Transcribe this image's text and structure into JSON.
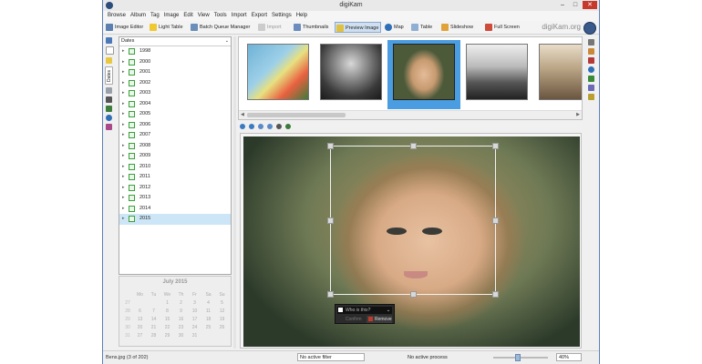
{
  "window": {
    "title": "digiKam",
    "brand": "digiKam.org"
  },
  "window_controls": {
    "minimize": "–",
    "maximize": "□",
    "close": "✕"
  },
  "menu": [
    "Browse",
    "Album",
    "Tag",
    "Image",
    "Edit",
    "View",
    "Tools",
    "Import",
    "Export",
    "Settings",
    "Help"
  ],
  "toolbar": {
    "image_editor": "Image Editor",
    "light_table": "Light Table",
    "batch_queue": "Batch Queue Manager",
    "import": "Import",
    "thumbnails": "Thumbnails",
    "preview": "Preview Image",
    "map": "Map",
    "table": "Table",
    "slideshow": "Slideshow",
    "full_screen": "Full Screen"
  },
  "left_sidebar": {
    "active_tab": "Dates"
  },
  "dates_panel": {
    "header": "Dates",
    "years": [
      "1998",
      "2000",
      "2001",
      "2002",
      "2003",
      "2004",
      "2005",
      "2006",
      "2007",
      "2008",
      "2009",
      "2010",
      "2011",
      "2012",
      "2013",
      "2014",
      "2015"
    ],
    "selected": "2015"
  },
  "calendar": {
    "title": "July 2015",
    "weekdays": [
      "Mo",
      "Tu",
      "We",
      "Th",
      "Fr",
      "Sa",
      "Su"
    ],
    "weeks": [
      {
        "wk": "27",
        "days": [
          "",
          "",
          "1",
          "2",
          "3",
          "4",
          "5"
        ]
      },
      {
        "wk": "28",
        "days": [
          "6",
          "7",
          "8",
          "9",
          "10",
          "11",
          "12"
        ]
      },
      {
        "wk": "29",
        "days": [
          "13",
          "14",
          "15",
          "16",
          "17",
          "18",
          "19"
        ]
      },
      {
        "wk": "30",
        "days": [
          "20",
          "21",
          "22",
          "23",
          "24",
          "25",
          "26"
        ]
      },
      {
        "wk": "31",
        "days": [
          "27",
          "28",
          "29",
          "30",
          "31",
          "",
          ""
        ]
      }
    ]
  },
  "face_tag": {
    "placeholder": "Who is this?",
    "confirm": "Confirm",
    "remove": "Remove"
  },
  "status": {
    "file": "Bens.jpg (3 of 202)",
    "filter": "No active filter",
    "process": "No active process",
    "zoom": "40%"
  },
  "colors": {
    "accent": "#4a9de0",
    "selection": "#cde6f7"
  }
}
